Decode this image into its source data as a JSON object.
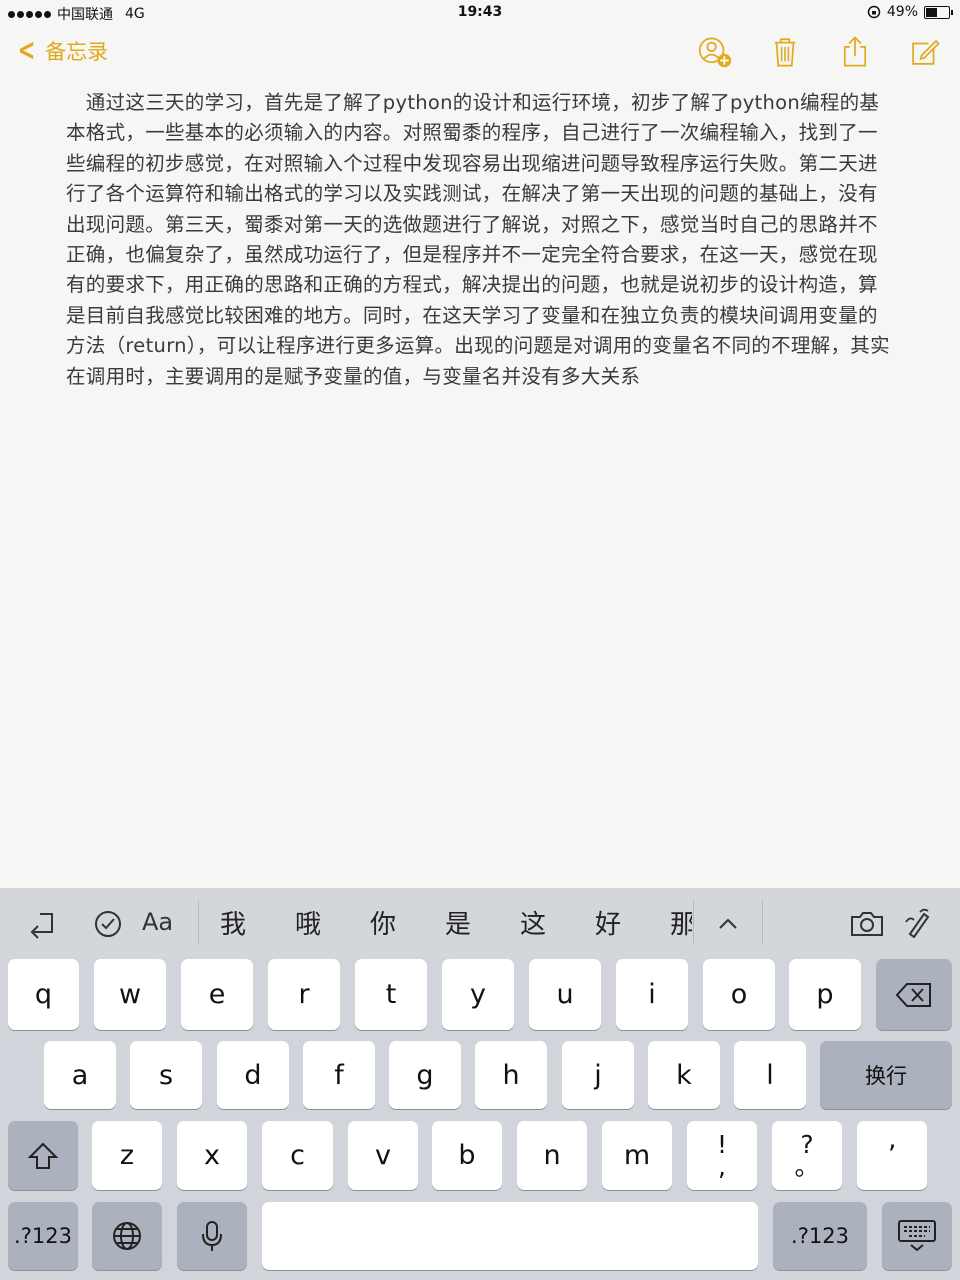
{
  "status": {
    "carrier": "中国联通",
    "network": "4G",
    "time": "19:43",
    "battery": "49%",
    "battery_level": 0.49
  },
  "nav": {
    "back_label": "备忘录",
    "accent": "#e1a91c"
  },
  "note": {
    "text": "　通过这三天的学习，首先是了解了python的设计和运行环境，初步了解了python编程的基本格式，一些基本的必须输入的内容。对照蜀黍的程序，自己进行了一次编程输入，找到了一些编程的初步感觉，在对照输入个过程中发现容易出现缩进问题导致程序运行失败。第二天进行了各个运算符和输出格式的学习以及实践测试，在解决了第一天出现的问题的基础上，没有出现问题。第三天，蜀黍对第一天的选做题进行了解说，对照之下，感觉当时自己的思路并不正确，也偏复杂了，虽然成功运行了，但是程序并不一定完全符合要求，在这一天，感觉在现有的要求下，用正确的思路和正确的方程式，解决提出的问题，也就是说初步的设计构造，算是目前自我感觉比较困难的地方。同时，在这天学习了变量和在独立负责的模块间调用变量的方法（return），可以让程序进行更多运算。出现的问题是对调用的变量名不同的不理解，其实在调用时，主要调用的是赋予变量的值，与变量名并没有多大关系"
  },
  "keyboard": {
    "format_label": "Aa",
    "suggestions": [
      "我",
      "哦",
      "你",
      "是",
      "这",
      "好",
      "那"
    ],
    "row1": [
      "q",
      "w",
      "e",
      "r",
      "t",
      "y",
      "u",
      "i",
      "o",
      "p"
    ],
    "row2": [
      "a",
      "s",
      "d",
      "f",
      "g",
      "h",
      "j",
      "k",
      "l"
    ],
    "row3": [
      "z",
      "x",
      "c",
      "v",
      "b",
      "n",
      "m"
    ],
    "punct1_top": "!",
    "punct1_bottom": ",",
    "punct2_top": "?",
    "punct2_bottom": "。",
    "punct3": "’",
    "return_label": "换行",
    "numbers_label": ".?123"
  }
}
